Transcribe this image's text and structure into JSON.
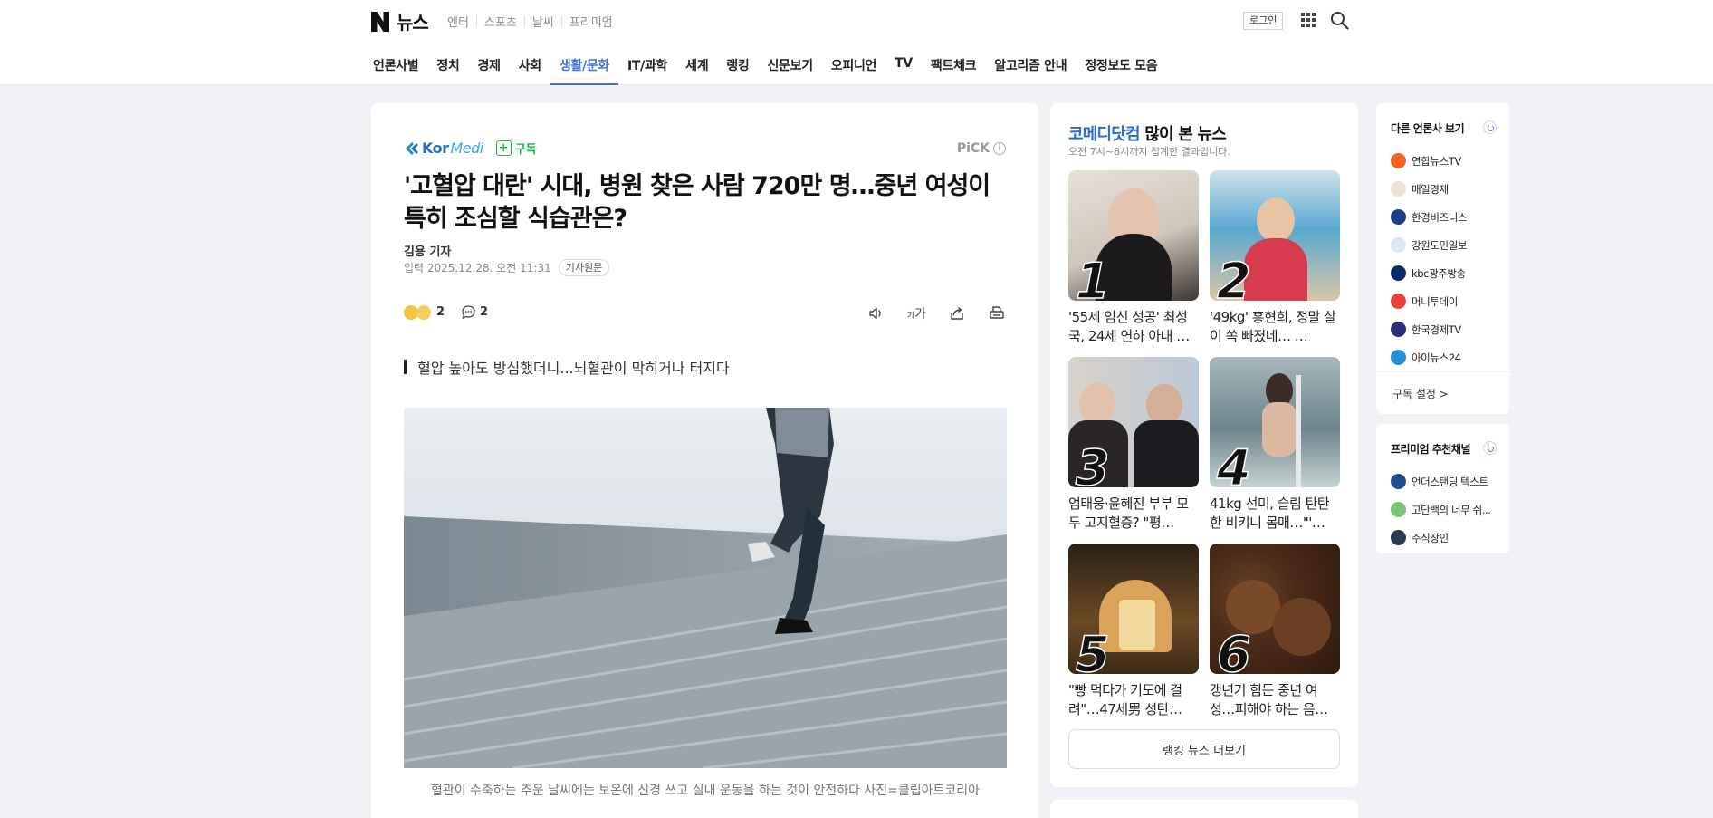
{
  "header": {
    "brand_title": "뉴스",
    "service_links": [
      "엔터",
      "스포츠",
      "날씨",
      "프리미엄"
    ],
    "login_label": "로그인"
  },
  "nav": {
    "items": [
      "언론사별",
      "정치",
      "경제",
      "사회",
      "생활/문화",
      "IT/과학",
      "세계",
      "랭킹",
      "신문보기",
      "오피니언",
      "TV",
      "팩트체크",
      "알고리즘 안내",
      "정정보도 모음"
    ],
    "active": "생활/문화",
    "accent_color": "#3b6fd8"
  },
  "article": {
    "press_name_1": "Kor",
    "press_name_2": "Medi",
    "subscribe_label": "구독",
    "pick_label": "PiCK",
    "headline": "'고혈압 대란' 시대, 병원 찾은 사람 720만 명…중년 여성이 특히 조심할 식습관은?",
    "reporter": "김용 기자",
    "dateline": "입력 2025.12.28. 오전 11:31",
    "original_label": "기사원문",
    "reaction_count": "2",
    "comment_count": "2",
    "font_size_label": "가",
    "summary": "혈압 높아도 방심했더니...뇌혈관이 막히거나 터지다",
    "caption": "혈관이 수축하는 추운 날씨에는 보온에 신경 쓰고 실내 운동을 하는 것이 안전하다 사진=클립아트코리아"
  },
  "ranking": {
    "press": "코메디닷컴",
    "title_suffix": " 많이 본 뉴스",
    "subtitle": "오전 7시~8시까지 집계한 결과입니다.",
    "items": [
      {
        "rank": "1",
        "text": "'55세 임신 성공' 최성국, 24세 연하 아내 …"
      },
      {
        "rank": "2",
        "text": "'49kg' 홍현희, 정말 살이 쏙 빠졌네… …"
      },
      {
        "rank": "3",
        "text": "엄태웅·윤혜진 부부 모두 고지혈증? \"평…"
      },
      {
        "rank": "4",
        "text": "41kg 선미, 슬림 탄탄한 비키니 몸매…\"'…"
      },
      {
        "rank": "5",
        "text": "\"빵 먹다가 기도에 걸려\"…47세男 성탄…"
      },
      {
        "rank": "6",
        "text": "갱년기 힘든 중년 여성…피해야 하는 음…"
      }
    ],
    "more_label": "랭킹 뉴스 더보기"
  },
  "sidebar": {
    "other_press_title": "다른 언론사 보기",
    "other_press": [
      {
        "name": "연합뉴스TV",
        "color": "#f26522"
      },
      {
        "name": "매일경제",
        "color": "#e9e4d4"
      },
      {
        "name": "한경비즈니스",
        "color": "#1d3f8a"
      },
      {
        "name": "강원도민일보",
        "color": "#dfe6f3"
      },
      {
        "name": "kbc광주방송",
        "color": "#0b2a6b"
      },
      {
        "name": "머니투데이",
        "color": "#e8413c"
      },
      {
        "name": "한국경제TV",
        "color": "#2b2f7c"
      },
      {
        "name": "아이뉴스24",
        "color": "#2491d6"
      }
    ],
    "subscribe_settings": "구독 설정 >",
    "premium_title": "프리미엄 추천채널",
    "premium_channels": [
      {
        "name": "언더스탠딩 텍스트",
        "color": "#1f4f8d"
      },
      {
        "name": "고단백의 너무 쉬...",
        "color": "#7cc47a"
      },
      {
        "name": "주식장인",
        "color": "#2b3a55"
      }
    ]
  }
}
